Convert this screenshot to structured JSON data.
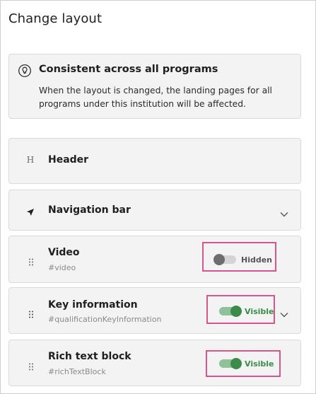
{
  "page": {
    "title": "Change layout"
  },
  "info": {
    "icon": "lightbulb-icon",
    "title": "Consistent across all programs",
    "body": "When the layout is changed, the landing pages for all programs under this institution will be affected."
  },
  "sections": [
    {
      "icon": "header-h-icon",
      "icon_glyph": "H",
      "label": "Header"
    },
    {
      "icon": "navigation-arrow-icon",
      "label": "Navigation bar",
      "expandable": true
    },
    {
      "icon": "drag-handle-icon",
      "label": "Video",
      "id": "#video",
      "visible": false,
      "status": "Hidden"
    },
    {
      "icon": "drag-handle-icon",
      "label": "Key information",
      "id": "#qualificationKeyInformation",
      "visible": true,
      "status": "Visible",
      "expandable": true
    },
    {
      "icon": "drag-handle-icon",
      "label": "Rich text block",
      "id": "#richTextBlock",
      "visible": true,
      "status": "Visible"
    }
  ],
  "colors": {
    "highlight": "#d6558b",
    "toggle_on": "#3d8b4a",
    "toggle_off": "#6d6d6d",
    "card_bg": "#f3f3f3"
  }
}
